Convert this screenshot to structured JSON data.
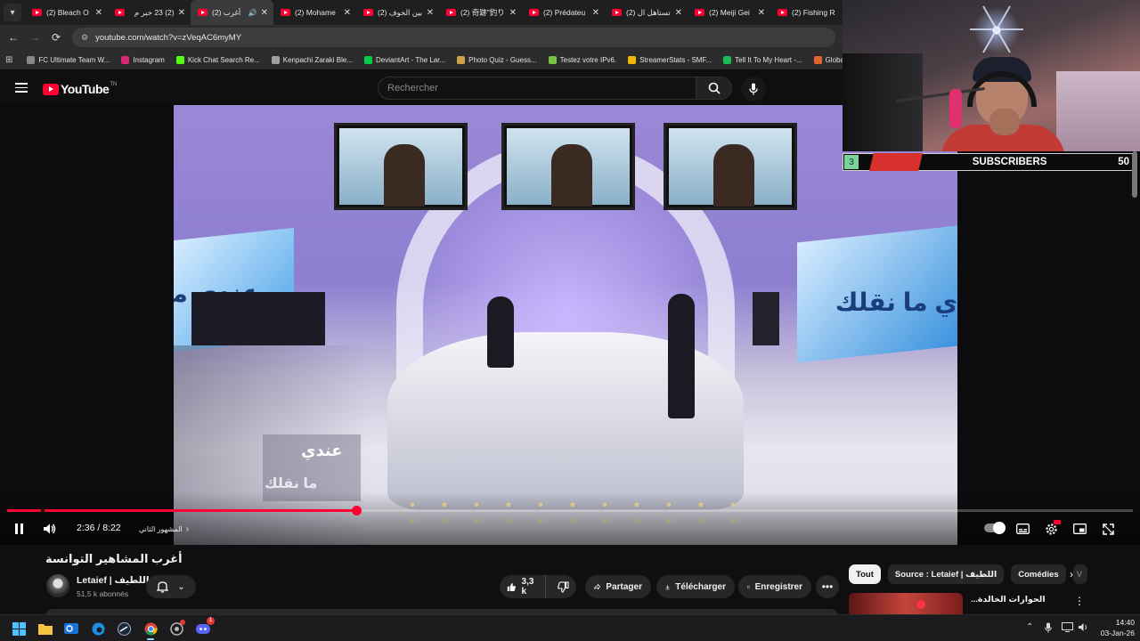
{
  "browser": {
    "tabs": [
      {
        "title": "(2) Bleach O",
        "active": false,
        "audio": false
      },
      {
        "title": "(2) 23 خبر م",
        "active": false,
        "audio": false
      },
      {
        "title": "(2) أغرب",
        "active": true,
        "audio": true
      },
      {
        "title": "(2) Mohame",
        "active": false,
        "audio": false
      },
      {
        "title": "(2) بين الخوف",
        "active": false,
        "audio": false
      },
      {
        "title": "(2) 奇跡\"釣り",
        "active": false,
        "audio": false
      },
      {
        "title": "(2) Prédateu",
        "active": false,
        "audio": false
      },
      {
        "title": "(2) تستاهل ال",
        "active": false,
        "audio": false
      },
      {
        "title": "(2) Meiji Gei",
        "active": false,
        "audio": false
      },
      {
        "title": "(2) Fishing R",
        "active": false,
        "audio": false
      }
    ],
    "url": "youtube.com/watch?v=zVeqAC6myMY",
    "bookmarks": [
      {
        "label": "FC Ultimate Team W...",
        "color": "#888888"
      },
      {
        "label": "Instagram",
        "color": "#d62976"
      },
      {
        "label": "Kick Chat Search Re...",
        "color": "#53fc18"
      },
      {
        "label": "Kenpachi Zaraki Ble...",
        "color": "#a0a0a0"
      },
      {
        "label": "DeviantArt - The Lar...",
        "color": "#05cc47"
      },
      {
        "label": "Photo Quiz - Guess...",
        "color": "#c9a24a"
      },
      {
        "label": "Testez votre IPv6.",
        "color": "#7ac142"
      },
      {
        "label": "StreamerStats - SMF...",
        "color": "#f2b705"
      },
      {
        "label": "Tell It To My Heart -...",
        "color": "#1db954"
      },
      {
        "label": "GlobalN",
        "color": "#e0642c"
      }
    ]
  },
  "youtube": {
    "logo_text": "YouTube",
    "country_code": "TN",
    "search_placeholder": "Rechercher",
    "player": {
      "current_time": "2:36",
      "duration": "8:22",
      "time_display": "2:36 / 8:22",
      "chapter_label": "المشهور الثاني",
      "progress_fraction": 0.31,
      "buffer_fraction": 0.31
    },
    "video": {
      "title": "أغرب المشاهير التوانسة",
      "channel_name": "Letaief | اللطيف",
      "subscribers": "51,5 k abonnés",
      "likes": "3,3 k",
      "share_label": "Partager",
      "download_label": "Télécharger",
      "save_label": "Enregistrer"
    },
    "scene_text": {
      "left_panel": "عندي ما",
      "right_panel": "ي ما نقلك",
      "caption_1": "عندي",
      "caption_2": "ما نقلك"
    },
    "chips": [
      {
        "label": "Tout",
        "active": true
      },
      {
        "label": "Source : Letaief | اللطيف",
        "active": false
      },
      {
        "label": "Comédies",
        "active": false
      },
      {
        "label": "V",
        "active": false
      }
    ],
    "recommendation": {
      "title": "الحوارات الخالدة..."
    }
  },
  "stream_overlay": {
    "badge": "3",
    "label": "SUBSCRIBERS",
    "count": "50"
  },
  "taskbar": {
    "time": "14:40",
    "date": "03-Jan-26",
    "apps": [
      "start-icon",
      "file-explorer-icon",
      "outlook-icon",
      "edge-icon",
      "steam-icon",
      "chrome-icon",
      "chrome-alt-icon",
      "discord-icon"
    ],
    "discord_badge": "1"
  },
  "colors": {
    "youtube_red": "#ff0033",
    "background": "#0f0f0f",
    "chip_bg": "#272727"
  }
}
